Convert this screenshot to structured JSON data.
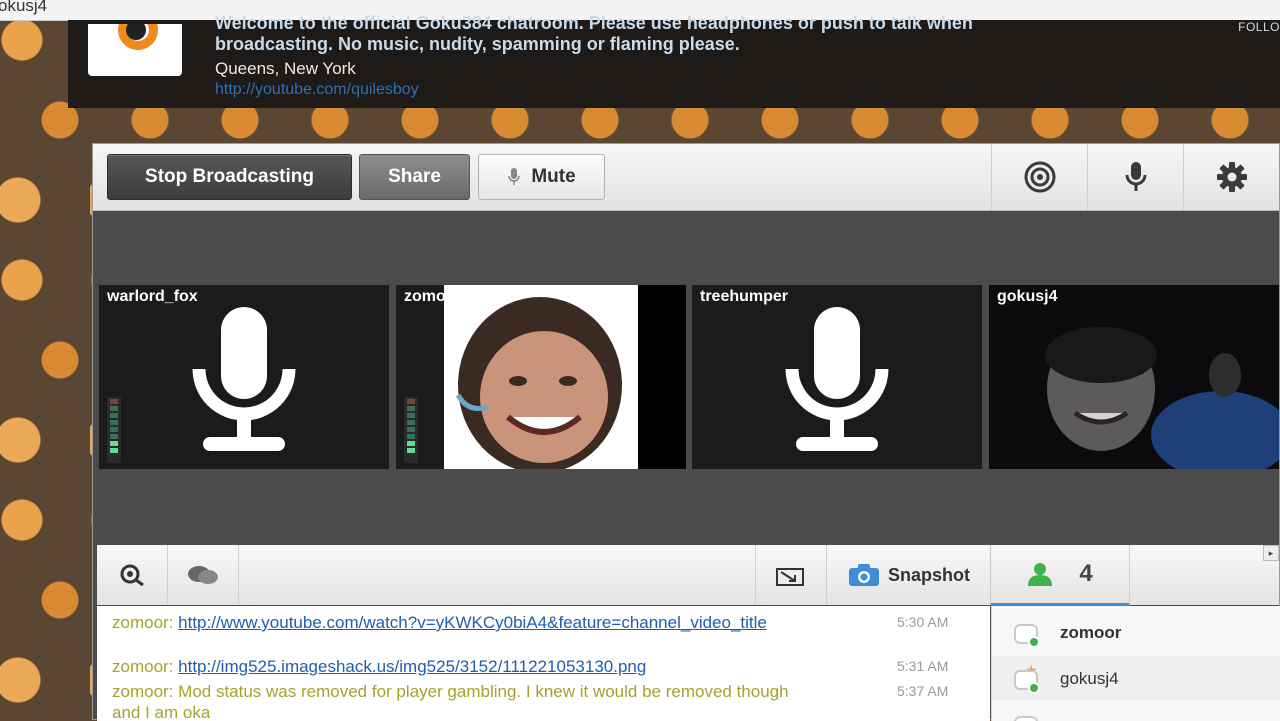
{
  "browser": {
    "tab_title": "okusj4"
  },
  "header": {
    "welcome": "Welcome to the official Goku384 chatroom. Please use headphones or push to talk when broadcasting. No music, nudity, spamming or flaming please.",
    "location": "Queens, New York",
    "link": "http://youtube.com/quilesboy",
    "follow_label": "FOLLO"
  },
  "toolbar": {
    "stop_label": "Stop Broadcasting",
    "share_label": "Share",
    "mute_label": "Mute",
    "icons": [
      "camera-settings-icon",
      "microphone-icon",
      "gear-icon"
    ]
  },
  "tiles": [
    {
      "name": "warlord_fox",
      "type": "audio"
    },
    {
      "name": "zomoor",
      "type": "video"
    },
    {
      "name": "treehumper",
      "type": "audio"
    },
    {
      "name": "gokusj4",
      "type": "video"
    }
  ],
  "chat": {
    "snapshot_label": "Snapshot",
    "messages": [
      {
        "user": "zomoor:",
        "link": "http://www.youtube.com/watch?v=yKWKCy0biA4&feature=channel_video_title",
        "time": "5:30 AM"
      },
      {
        "user": "zomoor:",
        "link": "http://img525.imageshack.us/img525/3152/111221053130.png",
        "time": "5:31 AM"
      },
      {
        "user": "zomoor:",
        "text": "Mod status was removed for player gambling. I knew it would be removed though and I am oka",
        "time": "5:37 AM"
      }
    ]
  },
  "users": {
    "count": "4",
    "list": [
      {
        "name": "zomoor",
        "bold": true
      },
      {
        "name": "gokusj4",
        "star": true
      },
      {
        "name": ""
      }
    ]
  },
  "colors": {
    "accent": "#3a8fd6",
    "online": "#3fb24b",
    "chat_text": "#a6a22e",
    "link": "#1c5fb0"
  }
}
